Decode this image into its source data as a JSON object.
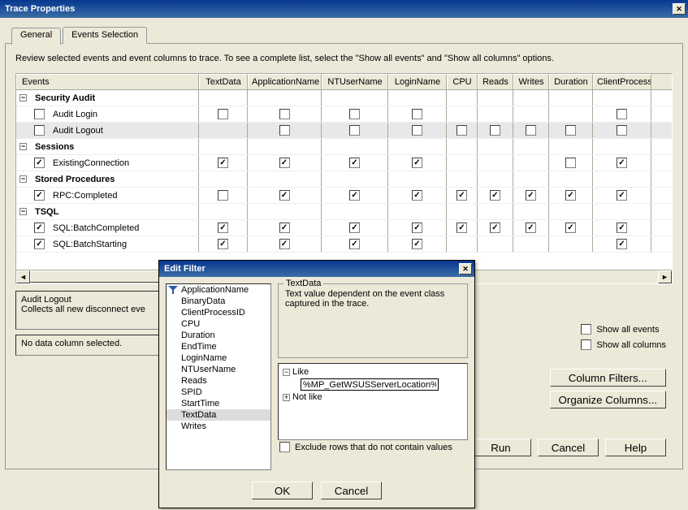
{
  "window": {
    "title": "Trace Properties"
  },
  "tabs": {
    "general": "General",
    "events": "Events Selection"
  },
  "instruction": "Review selected events and event columns to trace. To see a complete list, select the \"Show all events\" and \"Show all columns\" options.",
  "columns": {
    "events": "Events",
    "textdata": "TextData",
    "appname": "ApplicationName",
    "ntuser": "NTUserName",
    "login": "LoginName",
    "cpu": "CPU",
    "reads": "Reads",
    "writes": "Writes",
    "duration": "Duration",
    "client": "ClientProcess"
  },
  "categories": [
    {
      "name": "Security Audit",
      "rows": [
        {
          "label": "Audit Login",
          "row_checked": false,
          "cells": {
            "textdata": "u",
            "appname": "u",
            "ntuser": "u",
            "login": "u",
            "cpu": null,
            "reads": null,
            "writes": null,
            "duration": null,
            "client": "u"
          }
        },
        {
          "label": "Audit Logout",
          "row_checked": false,
          "highlight": true,
          "cells": {
            "textdata": null,
            "appname": "u",
            "ntuser": "u",
            "login": "u",
            "cpu": "u",
            "reads": "u",
            "writes": "u",
            "duration": "u",
            "client": "u"
          }
        }
      ]
    },
    {
      "name": "Sessions",
      "rows": [
        {
          "label": "ExistingConnection",
          "row_checked": true,
          "cells": {
            "textdata": "c",
            "appname": "c",
            "ntuser": "c",
            "login": "c",
            "cpu": null,
            "reads": null,
            "writes": null,
            "duration": "u",
            "client": "c"
          }
        }
      ]
    },
    {
      "name": "Stored Procedures",
      "rows": [
        {
          "label": "RPC:Completed",
          "row_checked": true,
          "cells": {
            "textdata": "u",
            "appname": "c",
            "ntuser": "c",
            "login": "c",
            "cpu": "c",
            "reads": "c",
            "writes": "c",
            "duration": "c",
            "client": "c"
          }
        }
      ]
    },
    {
      "name": "TSQL",
      "rows": [
        {
          "label": "SQL:BatchCompleted",
          "row_checked": true,
          "cells": {
            "textdata": "c",
            "appname": "c",
            "ntuser": "c",
            "login": "c",
            "cpu": "c",
            "reads": "c",
            "writes": "c",
            "duration": "c",
            "client": "c"
          }
        },
        {
          "label": "SQL:BatchStarting",
          "row_checked": true,
          "cells": {
            "textdata": "c",
            "appname": "c",
            "ntuser": "c",
            "login": "c",
            "cpu": null,
            "reads": null,
            "writes": null,
            "duration": null,
            "client": "c"
          }
        }
      ]
    }
  ],
  "desc1": {
    "title": "Audit Logout",
    "body": "Collects all new disconnect eve"
  },
  "desc2": {
    "body": "No data column selected."
  },
  "options": {
    "show_all_events": "Show all events",
    "show_all_columns": "Show all columns"
  },
  "buttons": {
    "column_filters": "Column Filters...",
    "organize_columns": "Organize Columns...",
    "run": "Run",
    "cancel": "Cancel",
    "help": "Help"
  },
  "modal": {
    "title": "Edit Filter",
    "columns": [
      "ApplicationName",
      "BinaryData",
      "ClientProcessID",
      "CPU",
      "Duration",
      "EndTime",
      "LoginName",
      "NTUserName",
      "Reads",
      "SPID",
      "StartTime",
      "TextData",
      "Writes"
    ],
    "filtered_col": "ApplicationName",
    "selected_col": "TextData",
    "fieldset_title": "TextData",
    "fieldset_desc": "Text value dependent on the event class captured in the trace.",
    "like": "Like",
    "not_like": "Not like",
    "filter_value": "%MP_GetWSUSServerLocation%",
    "exclude_label": "Exclude rows that do not contain values",
    "ok": "OK",
    "cancel": "Cancel"
  }
}
